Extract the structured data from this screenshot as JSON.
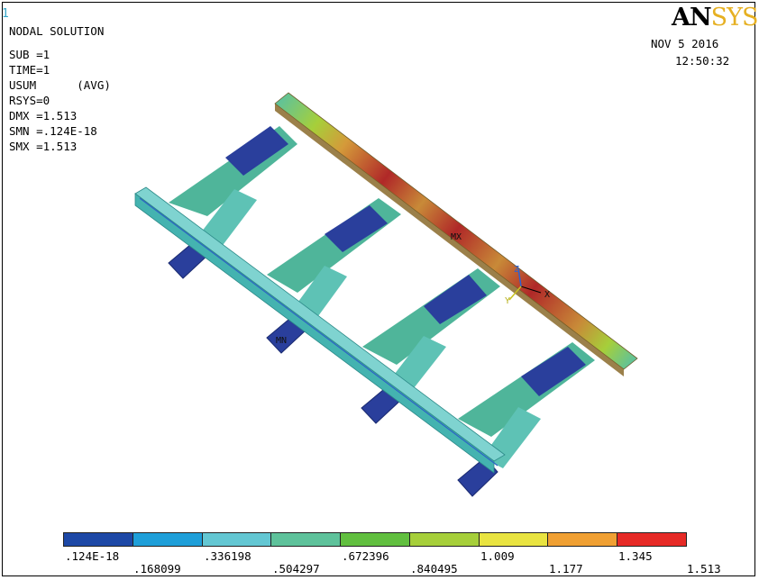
{
  "window_number": "1",
  "logo": {
    "part1": "AN",
    "part2": "SYS"
  },
  "header": {
    "date": "NOV  5 2016",
    "time": "12:50:32"
  },
  "info": {
    "title": "NODAL SOLUTION",
    "lines": [
      "SUB =1",
      "TIME=1",
      "USUM      (AVG)",
      "RSYS=0",
      "DMX =1.513",
      "SMN =.124E-18",
      "SMX =1.513"
    ]
  },
  "labels": {
    "max": "MX",
    "min": "MN",
    "axis_x": "X",
    "axis_y": "Y",
    "axis_z": "Z"
  },
  "legend": {
    "colors": [
      "#1d48a6",
      "#1e9fd9",
      "#63c7d3",
      "#5ec29b",
      "#61bf3f",
      "#a6cf3a",
      "#e9e441",
      "#f0a033",
      "#e62a26"
    ],
    "ticks_bottom_row": [
      ".124E-18",
      ".336198",
      ".672396",
      "1.009",
      "1.345"
    ],
    "ticks_top_row": [
      ".168099",
      ".504297",
      ".840495",
      "1.177",
      "1.513"
    ]
  }
}
